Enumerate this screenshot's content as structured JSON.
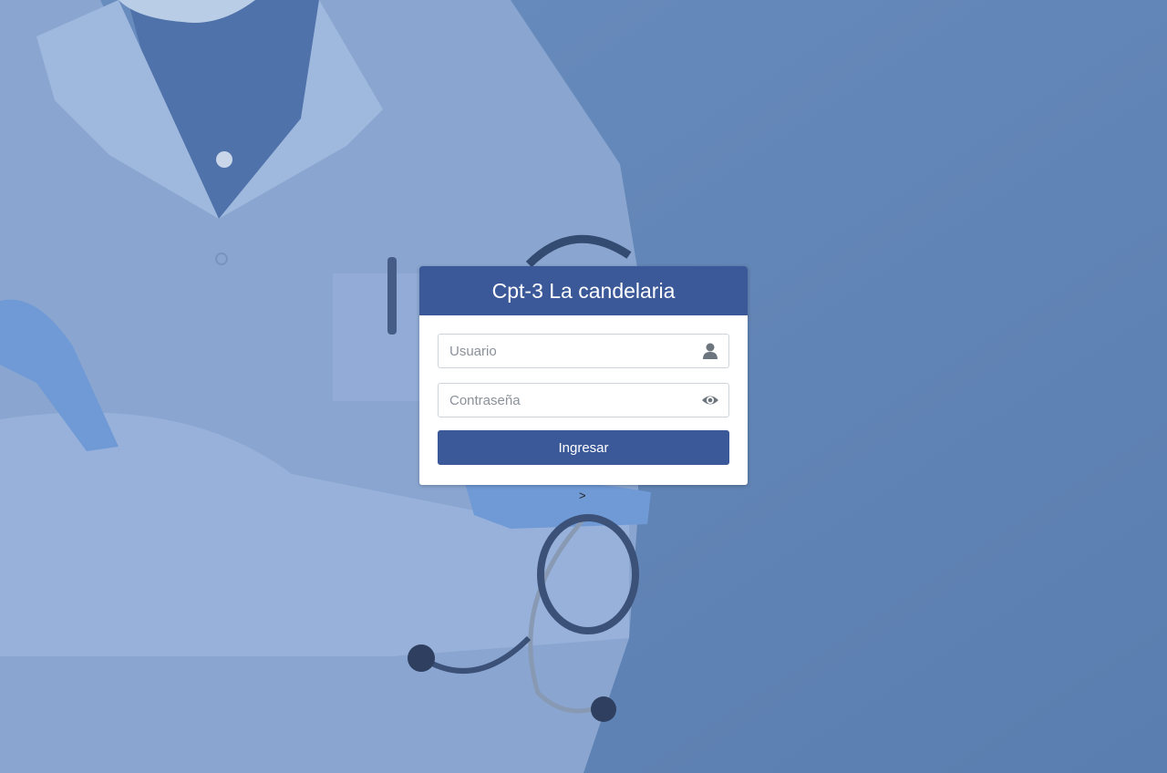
{
  "login": {
    "title": "Cpt-3 La candelaria",
    "username": {
      "placeholder": "Usuario",
      "value": "",
      "icon": "user-icon"
    },
    "password": {
      "placeholder": "Contraseña",
      "value": "",
      "icon": "eye-icon"
    },
    "submit_label": "Ingresar",
    "stray_text": ">"
  },
  "colors": {
    "overlay": "#6285b6",
    "brand": "#3b5998",
    "card": "#ffffff"
  },
  "background": {
    "icon": "doctor-with-stethoscope-image"
  }
}
